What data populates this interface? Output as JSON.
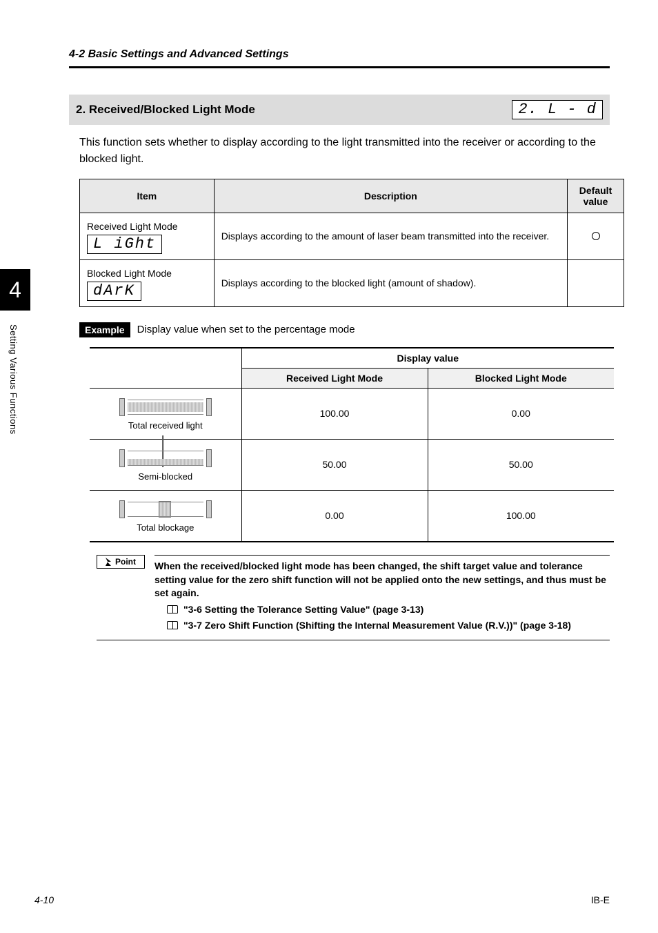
{
  "side": {
    "chapter_num": "4",
    "side_label": "Setting Various Functions"
  },
  "header": {
    "breadcrumb": "4-2  Basic Settings and Advanced Settings"
  },
  "section": {
    "num_title": "2. Received/Blocked Light Mode",
    "seg_code": "2.  L - d"
  },
  "intro": "This function sets whether to display according to the light transmitted into the receiver or according to the blocked light.",
  "spec_table": {
    "headers": {
      "item": "Item",
      "desc": "Description",
      "def": "Default value"
    },
    "rows": [
      {
        "item_top": "Received Light Mode",
        "item_seg": "L iGht",
        "desc": "Displays according to the amount of laser beam transmitted into the receiver.",
        "default": "circle"
      },
      {
        "item_top": "Blocked Light Mode",
        "item_seg": "dArK",
        "desc": "Displays according to the blocked light (amount of shadow).",
        "default": ""
      }
    ]
  },
  "example": {
    "badge": "Example",
    "text": "Display value when set to the percentage mode"
  },
  "disp_table": {
    "group_header": "Display value",
    "col_received": "Received Light Mode",
    "col_blocked": "Blocked Light Mode",
    "rows": [
      {
        "label": "Total received light",
        "received": "100.00",
        "blocked": "0.00",
        "kind": "full"
      },
      {
        "label": "Semi-blocked",
        "received": "50.00",
        "blocked": "50.00",
        "kind": "half"
      },
      {
        "label": "Total blockage",
        "received": "0.00",
        "blocked": "100.00",
        "kind": "blocked"
      }
    ]
  },
  "point": {
    "badge": "Point",
    "body": "When the received/blocked light mode has been changed, the shift target value and tolerance setting value for the zero shift function will not be applied onto the new settings, and thus must be set again.",
    "refs": [
      "\"3-6 Setting the Tolerance Setting Value\" (page 3-13)",
      "\"3-7 Zero Shift Function (Shifting the Internal Measurement Value (R.V.))\" (page 3-18)"
    ]
  },
  "footer": {
    "page": "4-10",
    "doc": "IB-E"
  }
}
